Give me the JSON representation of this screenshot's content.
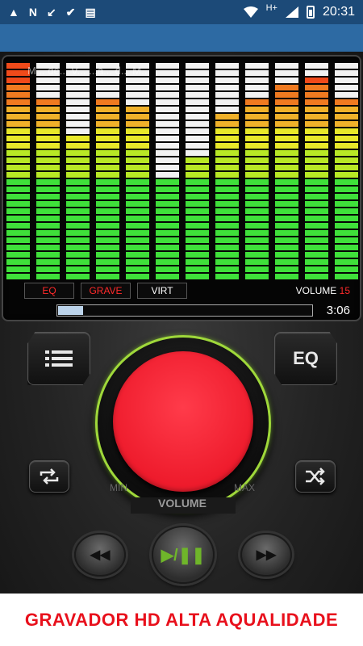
{
  "status_bar": {
    "time": "20:31",
    "network": "H+",
    "notification_icons": [
      "alert-icon",
      "n-icon",
      "missed-call-icon",
      "check-icon",
      "news-icon"
    ]
  },
  "player": {
    "song_title": "M... de... V... ...a... d... M...",
    "tags": {
      "eq": "EQ",
      "grave": "GRAVE",
      "virt": "VIRT"
    },
    "volume_label": "VOLUME",
    "volume_value": "15",
    "time": "3:06",
    "progress": 0.1,
    "spectrum_levels": [
      1.0,
      0.82,
      0.66,
      0.82,
      0.79,
      0.47,
      0.58,
      0.75,
      0.82,
      0.9,
      0.93,
      0.82
    ],
    "dial_min": "MIN",
    "dial_max": "MAX",
    "dial_label": "VOLUME",
    "eq_button_label": "EQ"
  },
  "footer": {
    "text": "GRAVADOR HD ALTA AQUALIDADE"
  },
  "colors": {
    "accent_red": "#ee1b2c",
    "ring_green": "#9fd83a",
    "status_bar": "#1c4a78",
    "app_bar": "#2d6aa3"
  }
}
